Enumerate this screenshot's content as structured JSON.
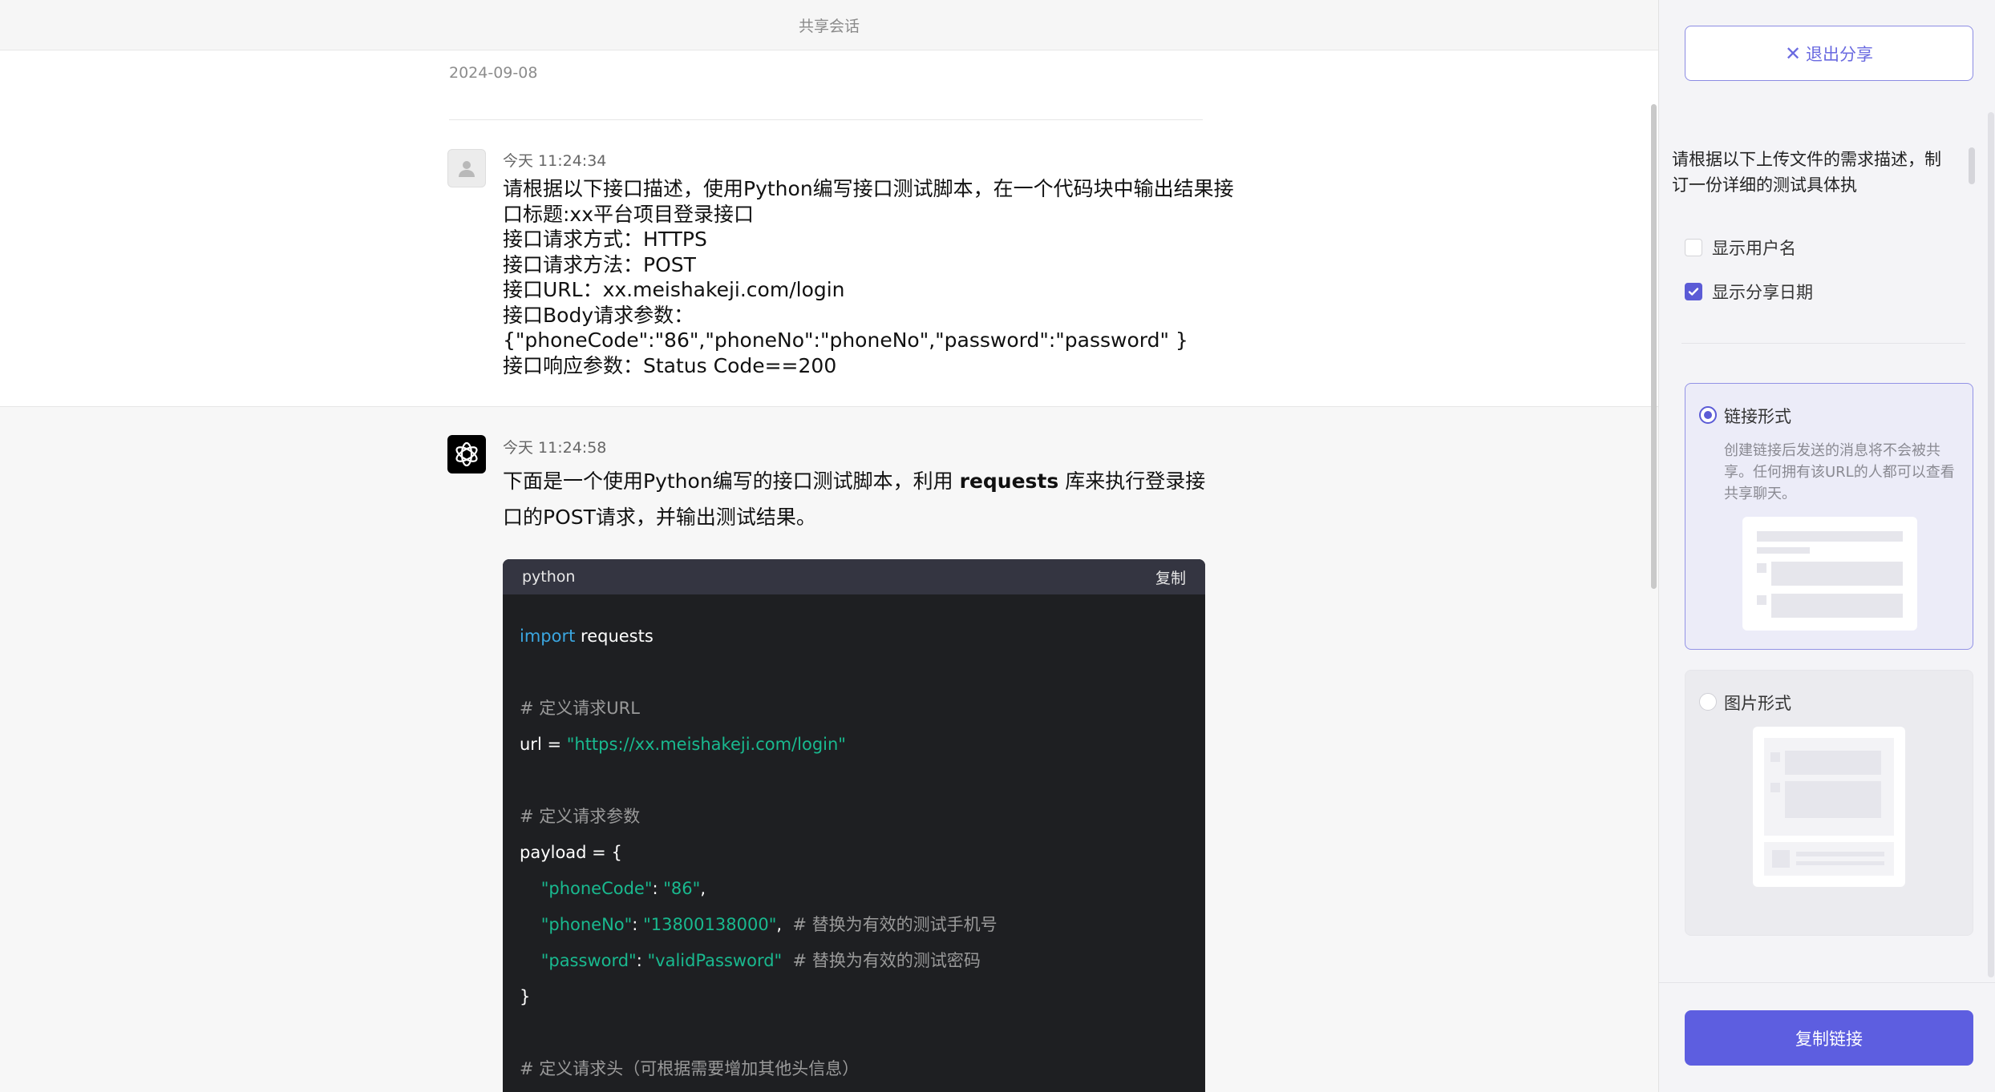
{
  "header": {
    "title": "共享会话"
  },
  "date_separator": "2024-09-08",
  "user_message": {
    "time": "今天 11:24:34",
    "lines": [
      "请根据以下接口描述，使用Python编写接口测试脚本，在一个代码块中输出结果接",
      "口标题:xx平台项目登录接口",
      "接口请求方式：HTTPS",
      "接口请求方法：POST",
      "接口URL：xx.meishakeji.com/login",
      "接口Body请求参数：",
      "{\"phoneCode\":\"86\",\"phoneNo\":\"phoneNo\",\"password\":\"password\" }",
      "接口响应参数：Status Code==200"
    ]
  },
  "ai_message": {
    "time": "今天 11:24:58",
    "intro_pre": "下面是一个使用Python编写的接口测试脚本，利用 ",
    "intro_bold": "requests",
    "intro_post": " 库来执行登录接口的POST请求，并输出测试结果。",
    "code": {
      "language": "python",
      "copy_label": "复制",
      "lines": {
        "l1_kw": "import",
        "l1_rest": " requests",
        "l3": "# 定义请求URL",
        "l4_a": "url = ",
        "l4_str": "\"https://xx.meishakeji.com/login\"",
        "l6": "# 定义请求参数",
        "l7": "payload = {",
        "l8_key": "\"phoneCode\"",
        "l8_colon": ": ",
        "l8_val": "\"86\"",
        "l8_end": ",",
        "l9_key": "\"phoneNo\"",
        "l9_colon": ": ",
        "l9_val": "\"13800138000\"",
        "l9_end": ",",
        "l9_cm": "  # 替换为有效的测试手机号",
        "l10_key": "\"password\"",
        "l10_colon": ": ",
        "l10_val": "\"validPassword\"",
        "l10_cm": "  # 替换为有效的测试密码",
        "l11": "}",
        "l13": "# 定义请求头（可根据需要增加其他头信息）"
      }
    }
  },
  "panel": {
    "exit_label": "退出分享",
    "prompt_preview": "请根据以下上传文件的需求描述，制订一份详细的测试具体执",
    "show_username_label": "显示用户名",
    "show_username_checked": false,
    "show_date_label": "显示分享日期",
    "show_date_checked": true,
    "option_link": {
      "title": "链接形式",
      "description": "创建链接后发送的消息将不会被共享。任何拥有该URL的人都可以查看共享聊天。",
      "selected": true
    },
    "option_image": {
      "title": "图片形式",
      "selected": false
    },
    "copy_link_label": "复制链接"
  },
  "colors": {
    "accent": "#5d5ee0",
    "code_bg": "#1e1f22",
    "code_keyword": "#3ba6e0",
    "code_string": "#19b98f",
    "code_comment": "#9a9a9a"
  }
}
